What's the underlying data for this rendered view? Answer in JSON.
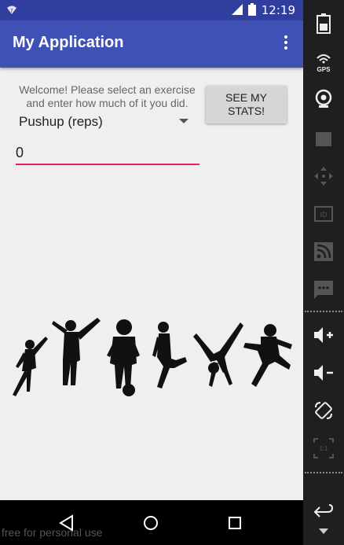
{
  "status_bar": {
    "time": "12:19"
  },
  "app_bar": {
    "title": "My Application"
  },
  "main": {
    "welcome_text": "Welcome! Please select an exercise and enter how much of it you did.",
    "stats_button_label": "SEE MY STATS!",
    "exercise_spinner": {
      "selected": "Pushup (reps)"
    },
    "amount_input": {
      "value": "0"
    }
  },
  "watermark": "free for personal use",
  "emulator_panel": {
    "gps_label": "GPS",
    "scale_label": "1:1"
  },
  "colors": {
    "primary": "#3f51b5",
    "primary_dark": "#303f9f",
    "accent": "#e91e63"
  }
}
